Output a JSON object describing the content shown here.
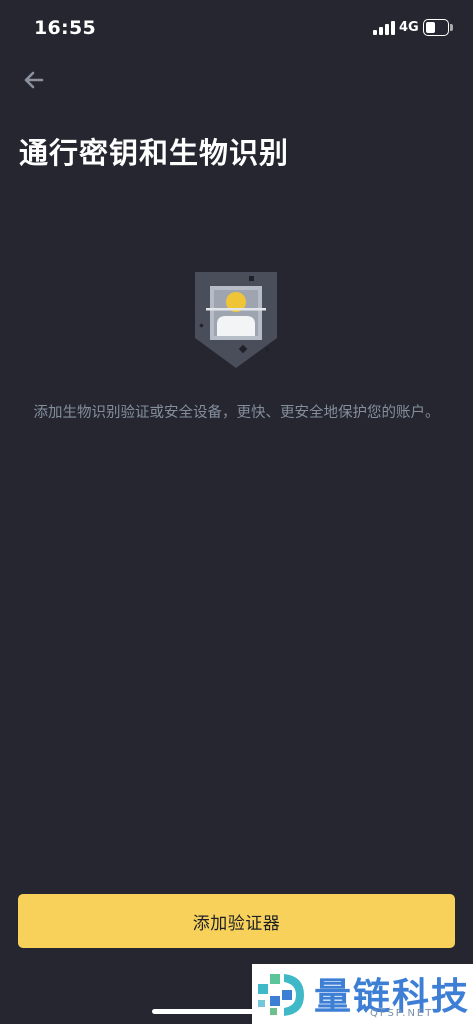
{
  "status_bar": {
    "time": "16:55",
    "network": "4G"
  },
  "header": {
    "back_icon": "arrow-left-icon",
    "title": "通行密钥和生物识别"
  },
  "illustration": {
    "icon": "face-scan-shield-icon"
  },
  "description": "添加生物识别验证或安全设备，更快、更安全地保护您的账户。",
  "primary_button": {
    "label": "添加验证器"
  },
  "watermark": {
    "title": "量链科技",
    "subtitle": "QFSP.NET"
  },
  "colors": {
    "background": "#252630",
    "accent": "#F7D15A",
    "text_primary": "#FFFFFF",
    "text_secondary": "#848E9C"
  }
}
